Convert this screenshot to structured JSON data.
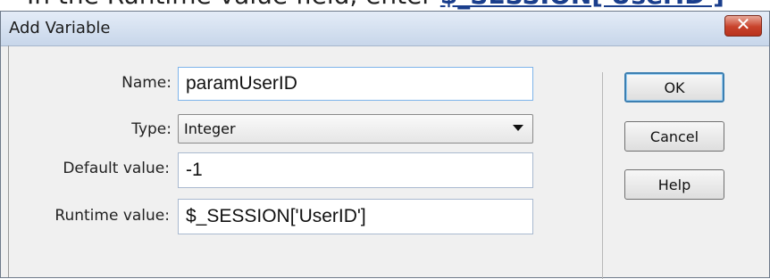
{
  "doc_text": {
    "prefix": "In the Runtime value field, enter ",
    "highlight": "$_SESSION['UserID']"
  },
  "dialog": {
    "title": "Add Variable",
    "close_glyph": "✕",
    "colors": {
      "titlebar": "#c7d6ea",
      "close": "#c8422b",
      "focus_border": "#7eb4ea",
      "default_button_border": "#3c7fb1"
    }
  },
  "form": {
    "name": {
      "label": "Name:",
      "value": "paramUserID"
    },
    "type": {
      "label": "Type:",
      "value": "Integer"
    },
    "default_value": {
      "label": "Default value:",
      "value": "-1"
    },
    "runtime_value": {
      "label": "Runtime value:",
      "value": "$_SESSION['UserID']"
    }
  },
  "buttons": {
    "ok": "OK",
    "cancel": "Cancel",
    "help": "Help"
  }
}
